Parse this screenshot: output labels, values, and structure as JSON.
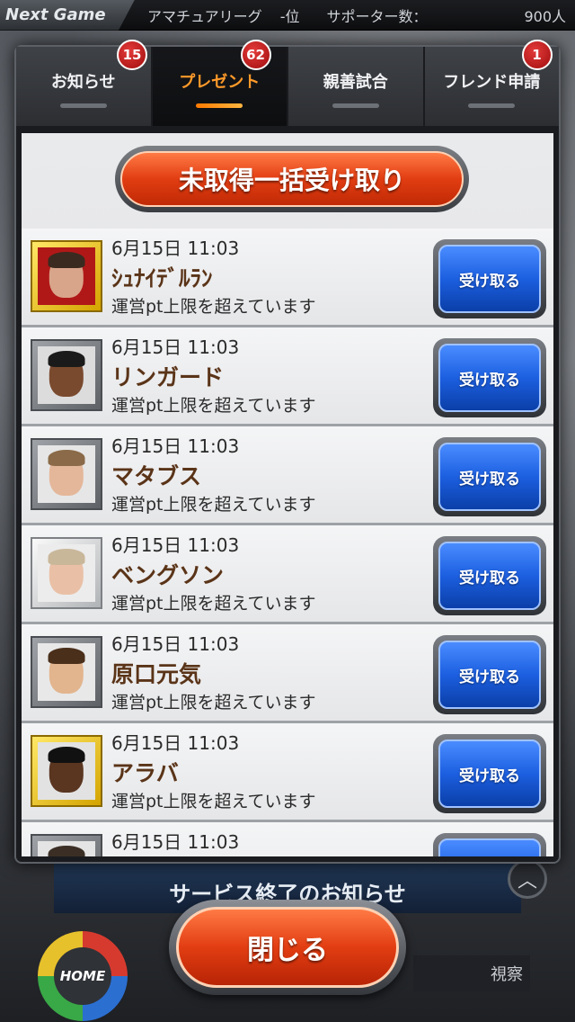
{
  "status_bar": {
    "game_label": "Next Game",
    "league": "アマチュアリーグ",
    "rank": "-位",
    "supporters_label": "サポーター数：",
    "supporters_value": "900人"
  },
  "tabs": [
    {
      "label": "お知らせ",
      "badge": "15",
      "active": false
    },
    {
      "label": "プレゼント",
      "badge": "62",
      "active": true
    },
    {
      "label": "親善試合",
      "badge": "",
      "active": false
    },
    {
      "label": "フレンド申請",
      "badge": "1",
      "active": false
    }
  ],
  "claim_all_label": "未取得一括受け取り",
  "receive_label": "受け取る",
  "presents": [
    {
      "date": "6月15日 11:03",
      "name": "ｼｭﾅｲﾃﾞﾙﾗﾝ",
      "note": "運営pt上限を超えています",
      "frame": "gold",
      "skin": "#d9a58a",
      "hair": "#3b2a1f",
      "bg": "#b01818"
    },
    {
      "date": "6月15日 11:03",
      "name": "リンガード",
      "note": "運営pt上限を超えています",
      "frame": "gray",
      "skin": "#7a4a2e",
      "hair": "#1a1a1a",
      "bg": "#dcdcdc"
    },
    {
      "date": "6月15日 11:03",
      "name": "マタブス",
      "note": "運営pt上限を超えています",
      "frame": "gray",
      "skin": "#e4b79a",
      "hair": "#8a6a48",
      "bg": "#e6e6e6"
    },
    {
      "date": "6月15日 11:03",
      "name": "ベングソン",
      "note": "運営pt上限を超えています",
      "frame": "silver",
      "skin": "#e9c0a6",
      "hair": "#c9b79a",
      "bg": "#ececec"
    },
    {
      "date": "6月15日 11:03",
      "name": "原口元気",
      "note": "運営pt上限を超えています",
      "frame": "gray",
      "skin": "#e2b58e",
      "hair": "#4a2f1a",
      "bg": "#e8e8e8"
    },
    {
      "date": "6月15日 11:03",
      "name": "アラバ",
      "note": "運営pt上限を超えています",
      "frame": "gold",
      "skin": "#5a3520",
      "hair": "#111111",
      "bg": "#e2e2e2"
    },
    {
      "date": "6月15日 11:03",
      "name": "",
      "note": "",
      "frame": "gray",
      "skin": "#d9aa8e",
      "hair": "#3b2f25",
      "bg": "#e4e4e4"
    }
  ],
  "background": {
    "news_title": "サービス終了のお知らせ",
    "home_label": "HOME",
    "watch_label": "視察"
  },
  "close_label": "閉じる"
}
